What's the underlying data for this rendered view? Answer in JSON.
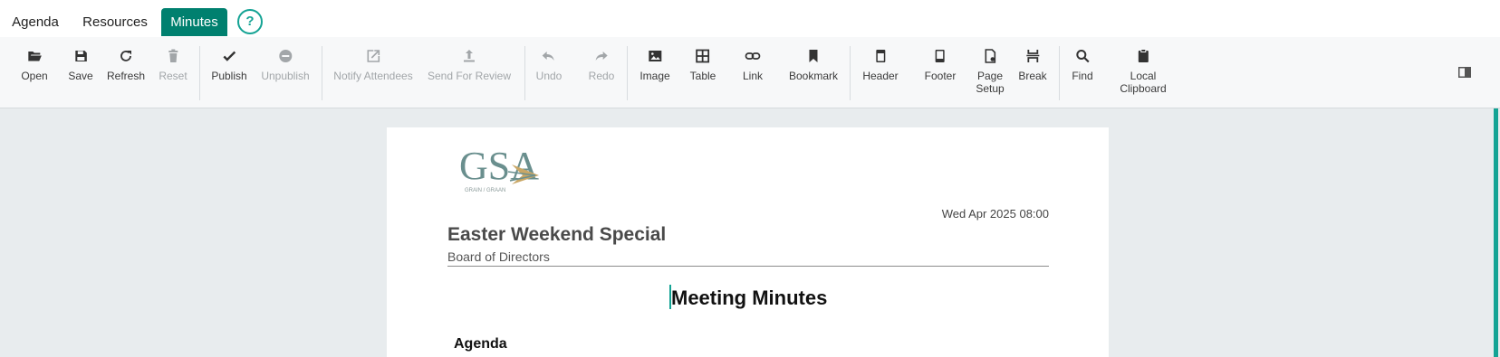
{
  "tabs": [
    {
      "label": "Agenda",
      "active": false
    },
    {
      "label": "Resources",
      "active": false
    },
    {
      "label": "Minutes",
      "active": true
    }
  ],
  "help_label": "?",
  "toolbar": {
    "open": "Open",
    "save": "Save",
    "refresh": "Refresh",
    "reset": "Reset",
    "publish": "Publish",
    "unpublish": "Unpublish",
    "notify_attendees": "Notify Attendees",
    "send_for_review": "Send For Review",
    "undo": "Undo",
    "redo": "Redo",
    "image": "Image",
    "table": "Table",
    "link": "Link",
    "bookmark": "Bookmark",
    "header": "Header",
    "footer": "Footer",
    "page_setup_line1": "Page",
    "page_setup_line2": "Setup",
    "break": "Break",
    "find": "Find",
    "local_clipboard_line1": "Local",
    "local_clipboard_line2": "Clipboard"
  },
  "document": {
    "logo_text": "GSA",
    "logo_subtext": "GRAIN / GRAAN",
    "date": "Wed Apr 2025 08:00",
    "title": "Easter Weekend Special",
    "subtitle": "Board of Directors",
    "heading": "Meeting Minutes",
    "section_heading": "Agenda"
  },
  "colors": {
    "accent": "#00806f",
    "accent_light": "#14a394",
    "disabled_text": "#a2a6a9"
  }
}
